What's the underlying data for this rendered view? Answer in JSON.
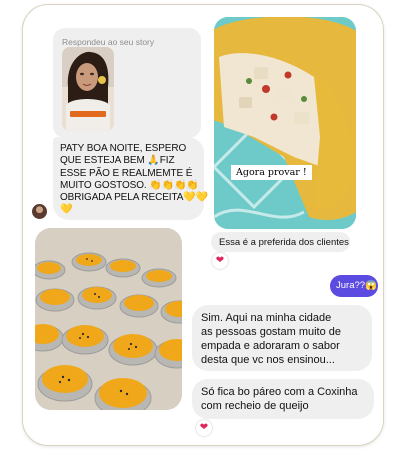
{
  "story_reply": {
    "caption": "Respondeu ao seu story",
    "thumb_sticker_text": ""
  },
  "messages": {
    "paty": {
      "lines": [
        "PATY BOA NOITE, ESPERO",
        "QUE ESTEJA BEM 🙏FIZ",
        "ESSE PÃO  E REALMEMTE É",
        "MUITO GOSTOSO. 👏👏👏👏",
        "OBRIGADA PELA RECEITA💛💛",
        "💛"
      ]
    },
    "pie_photo_label": "Agora provar !",
    "favorite": "Essa é a preferida dos clientes",
    "jura": "Jura??😱",
    "sim": {
      "lines": [
        "Sim. Aqui na minha cidade",
        "as pessoas gostam muito de",
        "empada e adoraram o sabor",
        "desta que vc nos ensinou..."
      ]
    },
    "coxinha": {
      "lines": [
        "Só fica bo páreo com a Coxinha",
        "com recheio de queijo"
      ]
    }
  },
  "reactions": {
    "favorite_heart": "❤",
    "coxinha_heart": "❤"
  },
  "colors": {
    "bubble_gray": "#efefef",
    "outgoing_purple": "#5b4be0",
    "heart_red": "#e0245e",
    "frame_border": "#d9d3bf"
  }
}
